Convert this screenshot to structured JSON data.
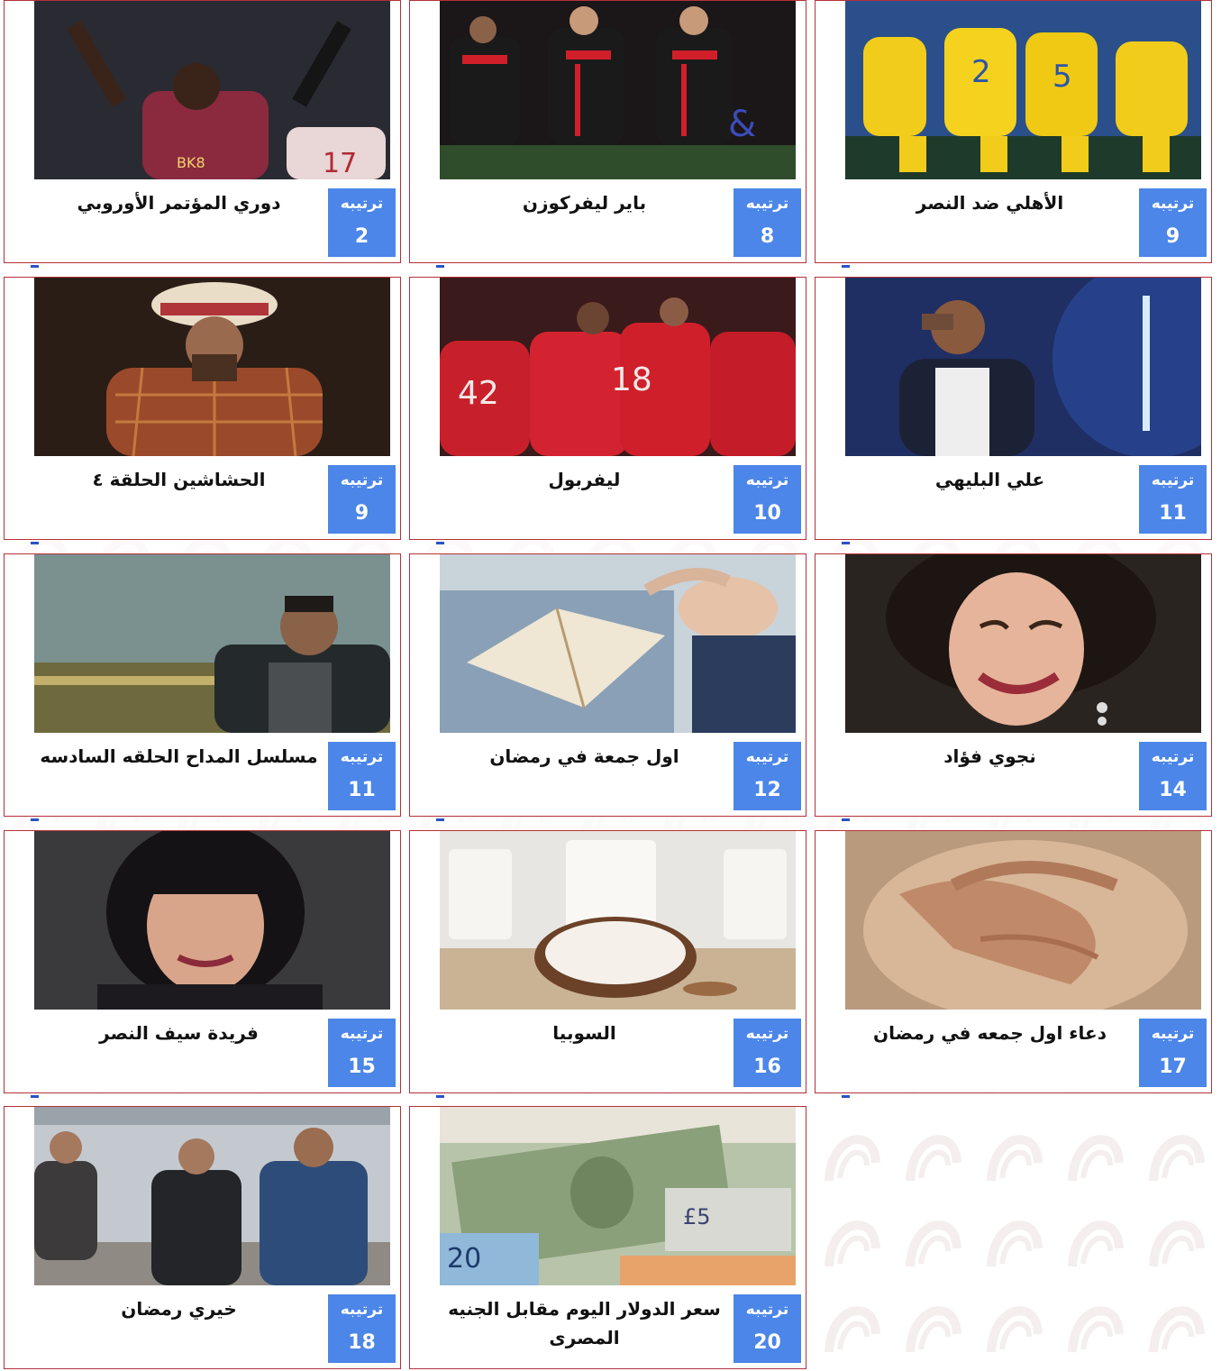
{
  "rank_label": "ترتيبه",
  "colors": {
    "border": "#b5313a",
    "badge": "#4b86e8",
    "text": "#111111"
  },
  "cards": [
    {
      "title": "الأهلي ضد النصر",
      "rank": "9",
      "image": "football-yellow-kits"
    },
    {
      "title": "باير ليفركوزن",
      "rank": "8",
      "image": "football-red-black-kits"
    },
    {
      "title": "دوري المؤتمر الأوروبي",
      "rank": "2",
      "image": "football-celebration"
    },
    {
      "title": "علي البليهي",
      "rank": "11",
      "image": "player-portrait"
    },
    {
      "title": "ليفربول",
      "rank": "10",
      "image": "football-red-kits"
    },
    {
      "title": "الحشاشين الحلقة ٤",
      "rank": "9",
      "image": "drama-character"
    },
    {
      "title": "نجوي فؤاد",
      "rank": "14",
      "image": "woman-portrait"
    },
    {
      "title": "اول جمعة في رمضان",
      "rank": "12",
      "image": "prayer-quran"
    },
    {
      "title": "مسلسل المداح الحلقه السادسه",
      "rank": "11",
      "image": "drama-scene"
    },
    {
      "title": "دعاء اول جمعه في رمضان",
      "rank": "17",
      "image": "praying-hands"
    },
    {
      "title": "السوبيا",
      "rank": "16",
      "image": "coconut-drink"
    },
    {
      "title": "فريدة سيف النصر",
      "rank": "15",
      "image": "actress-portrait"
    },
    {
      "title": "سعر الدولار اليوم مقابل الجنيه المصرى",
      "rank": "20",
      "image": "currency-banknotes"
    },
    {
      "title": "خيري رمضان",
      "rank": "18",
      "image": "group-outdoors"
    }
  ]
}
